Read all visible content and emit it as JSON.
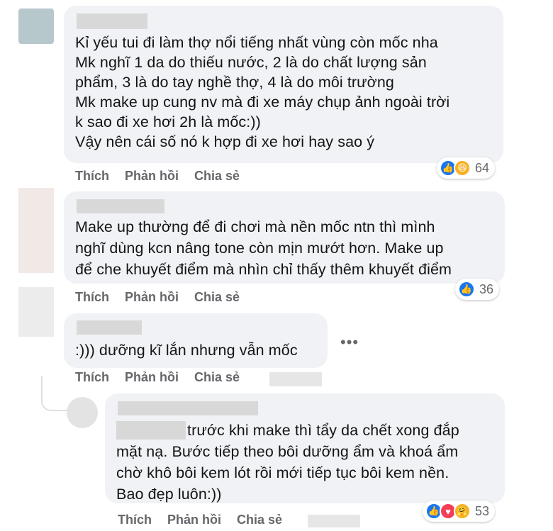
{
  "comments": [
    {
      "lines": [
        "Kỉ yếu tui đi làm thợ nổi tiếng nhất vùng còn mốc nha",
        "Mk nghĩ 1 da do thiếu nước, 2 là do chất lượng sản",
        "phẩm, 3 là do tay nghề thợ, 4 là do môi trường",
        "Mk make up cung nv mà đi xe máy chụp ảnh ngoài trời",
        "k sao đi xe hơi 2h là mốc:))",
        "Vậy nên cái số nó k hợp đi xe hơi hay sao ý"
      ],
      "actions": [
        "Thích",
        "Phản hồi",
        "Chia sẻ"
      ],
      "reactions": {
        "icons": [
          "like-icon",
          "haha-icon"
        ],
        "count": "64"
      }
    },
    {
      "lines": [
        "Make up thường để đi chơi mà nền mốc ntn thì mình",
        "nghĩ dùng kcn nâng tone còn mịn mướt hơn. Make up",
        "để che khuyết điểm mà nhìn chỉ thấy thêm khuyết điểm"
      ],
      "actions": [
        "Thích",
        "Phản hồi",
        "Chia sẻ"
      ],
      "reactions": {
        "icons": [
          "like-icon"
        ],
        "count": "36"
      }
    },
    {
      "lines": [
        ":))) dưỡng kĩ lắn nhưng vẫn mốc"
      ],
      "actions": [
        "Thích",
        "Phản hồi",
        "Chia sẻ"
      ],
      "more": "•••"
    },
    {
      "lines": [
        "trước khi make thì tẩy da chết xong đắp",
        "mặt nạ. Bước tiếp theo bôi dưỡng ẩm và khoá ẩm",
        "chờ khô bôi kem lót rồi mới tiếp tục bôi kem nền.",
        "Bao đẹp luôn:))"
      ],
      "actions": [
        "Thích",
        "Phản hồi",
        "Chia sẻ"
      ],
      "reactions": {
        "icons": [
          "like-icon",
          "love-icon",
          "care-icon"
        ],
        "count": "53"
      }
    }
  ],
  "colors": {
    "bubble": "#f0f2f5",
    "like": "#1877f2",
    "love": "#f33e58",
    "haha": "#f7b125",
    "action_text": "#65676b"
  }
}
